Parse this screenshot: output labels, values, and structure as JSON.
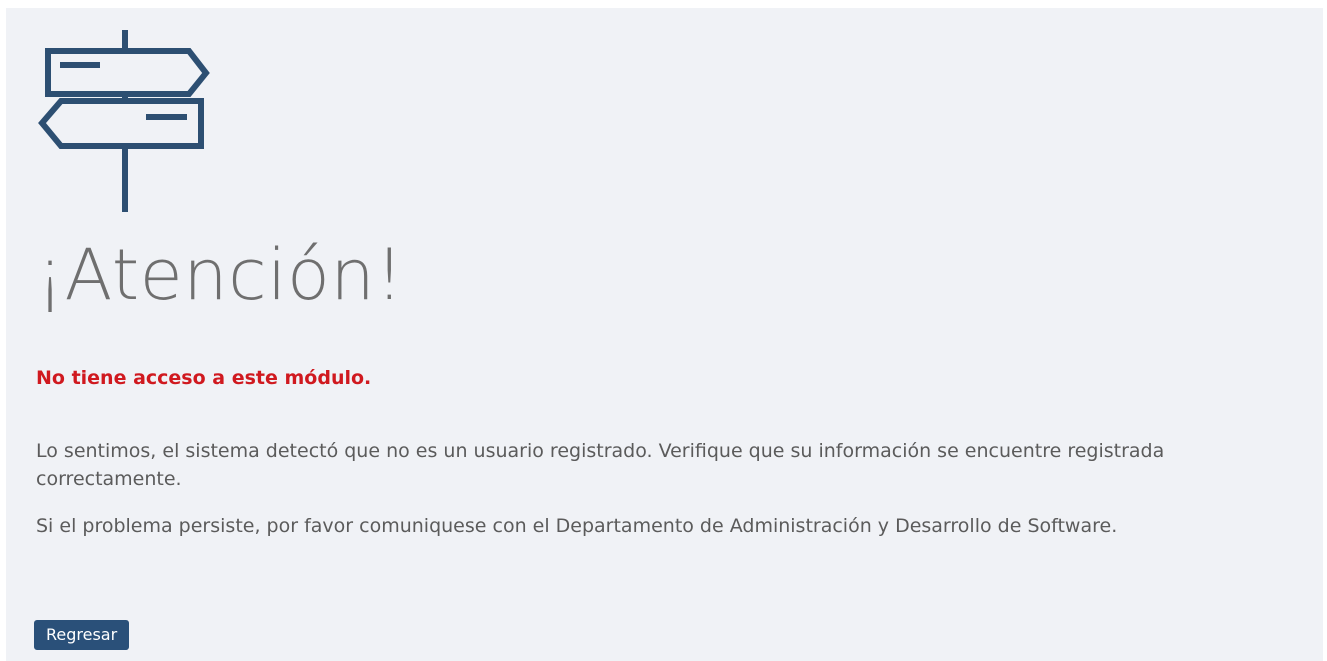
{
  "page": {
    "background_color": "#f0f2f6",
    "icon": "signpost-icon",
    "icon_color": "#2d4f72",
    "heading": "¡Atención!",
    "error_message": "No tiene acceso a este módulo.",
    "error_color": "#d0191f",
    "paragraphs": [
      "Lo sentimos, el sistema detectó que no es un usuario registrado. Verifique que su información se encuentre registrada correctamente.",
      "Si el problema persiste, por favor comuniquese con el Departamento de Administración y Desarrollo de Software."
    ],
    "button": {
      "label": "Regresar",
      "color": "#2a5079"
    }
  }
}
